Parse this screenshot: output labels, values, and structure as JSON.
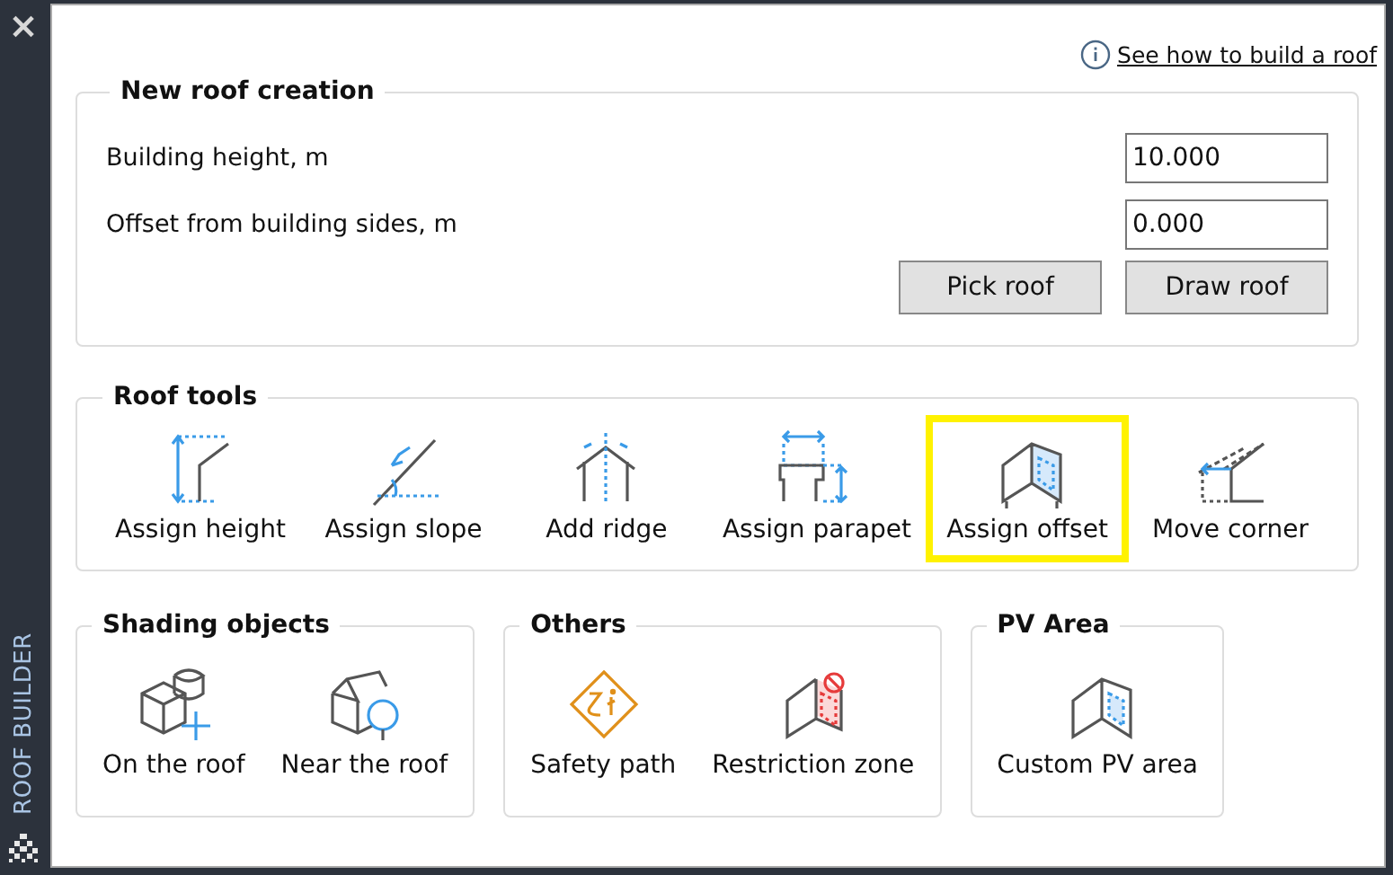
{
  "sidebar": {
    "close": "×",
    "title": "ROOF BUILDER"
  },
  "help_link": "See how to build a roof",
  "new_roof": {
    "title": "New roof creation",
    "fields": [
      {
        "label": "Building height, m",
        "value": "10.000"
      },
      {
        "label": "Offset from building sides, m",
        "value": "0.000"
      }
    ],
    "buttons": [
      "Pick roof",
      "Draw roof"
    ]
  },
  "roof_tools": {
    "title": "Roof tools",
    "items": [
      {
        "label": "Assign height",
        "selected": false
      },
      {
        "label": "Assign slope",
        "selected": false
      },
      {
        "label": "Add ridge",
        "selected": false
      },
      {
        "label": "Assign parapet",
        "selected": false
      },
      {
        "label": "Assign offset",
        "selected": true
      },
      {
        "label": "Move corner",
        "selected": false
      }
    ]
  },
  "groups": [
    {
      "title": "Shading objects",
      "items": [
        {
          "label": "On the roof"
        },
        {
          "label": "Near the roof"
        }
      ]
    },
    {
      "title": "Others",
      "items": [
        {
          "label": "Safety path"
        },
        {
          "label": "Restriction zone"
        }
      ]
    },
    {
      "title": "PV Area",
      "items": [
        {
          "label": "Custom PV area"
        }
      ]
    }
  ]
}
